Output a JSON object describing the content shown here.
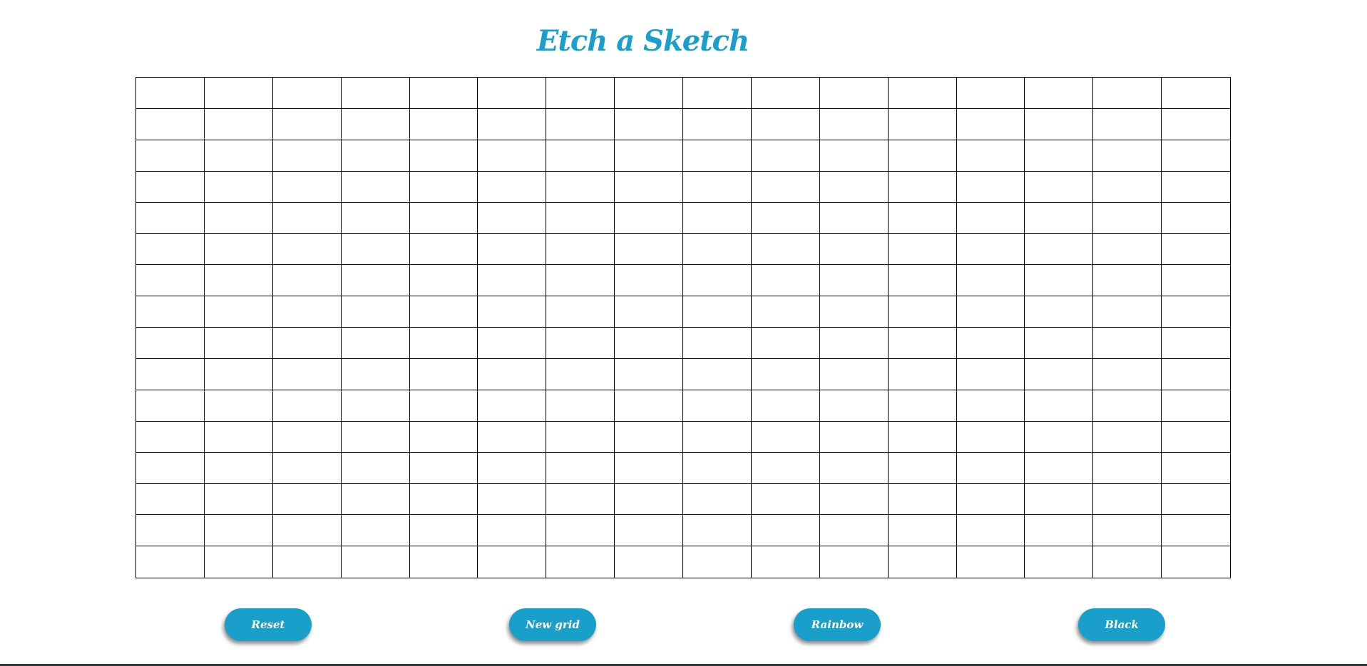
{
  "app": {
    "title": "Etch a Sketch"
  },
  "grid": {
    "rows": 16,
    "columns": 16,
    "cell_color": "#ffffff",
    "line_color": "#000000"
  },
  "buttons": {
    "reset_label": "Reset",
    "new_grid_label": "New grid",
    "rainbow_label": "Rainbow",
    "black_label": "Black"
  },
  "colors": {
    "accent": "#1a9fcb",
    "background": "#ffffff",
    "button_text": "#ffffff"
  }
}
